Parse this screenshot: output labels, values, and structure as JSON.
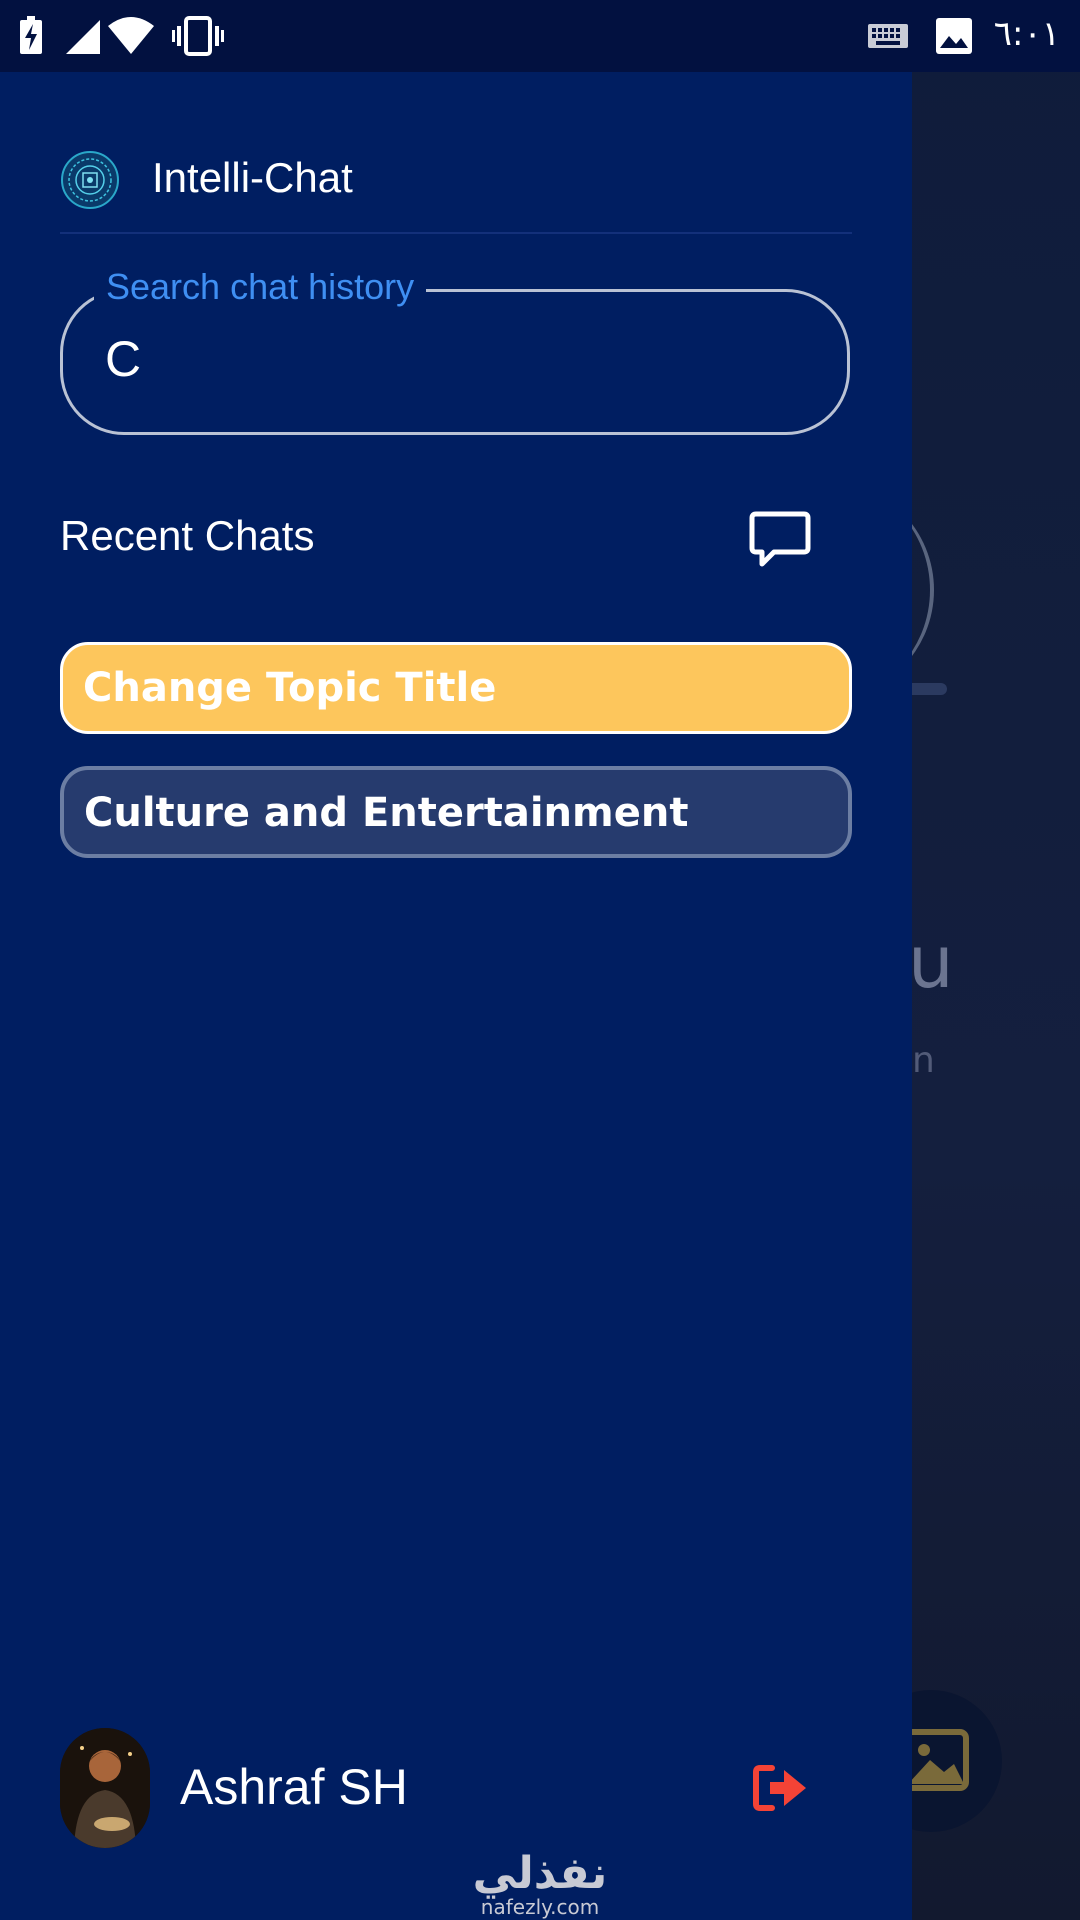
{
  "status_bar": {
    "time": "٦:٠١",
    "icons": [
      "battery-charging-icon",
      "cell-signal-icon",
      "wifi-icon",
      "vibrate-icon",
      "keyboard-icon",
      "image-icon"
    ]
  },
  "background": {
    "partial_title": "u",
    "partial_subtitle": "n"
  },
  "drawer": {
    "app_title": "Intelli-Chat",
    "search": {
      "label": "Search chat history",
      "value": "C"
    },
    "recent_title": "Recent Chats",
    "chats": [
      {
        "title": "Change Topic Title",
        "active": true
      },
      {
        "title": "Culture and Entertainment",
        "active": false
      }
    ],
    "user": {
      "name": "Ashraf SH"
    }
  },
  "watermark": {
    "arabic": "نفذلي",
    "url": "nafezly.com"
  },
  "colors": {
    "drawer_bg": "#001e61",
    "active_chat": "#fdc65c",
    "inactive_chat": "#263b6e",
    "search_label": "#3f8ff2",
    "logout": "#f44336"
  }
}
